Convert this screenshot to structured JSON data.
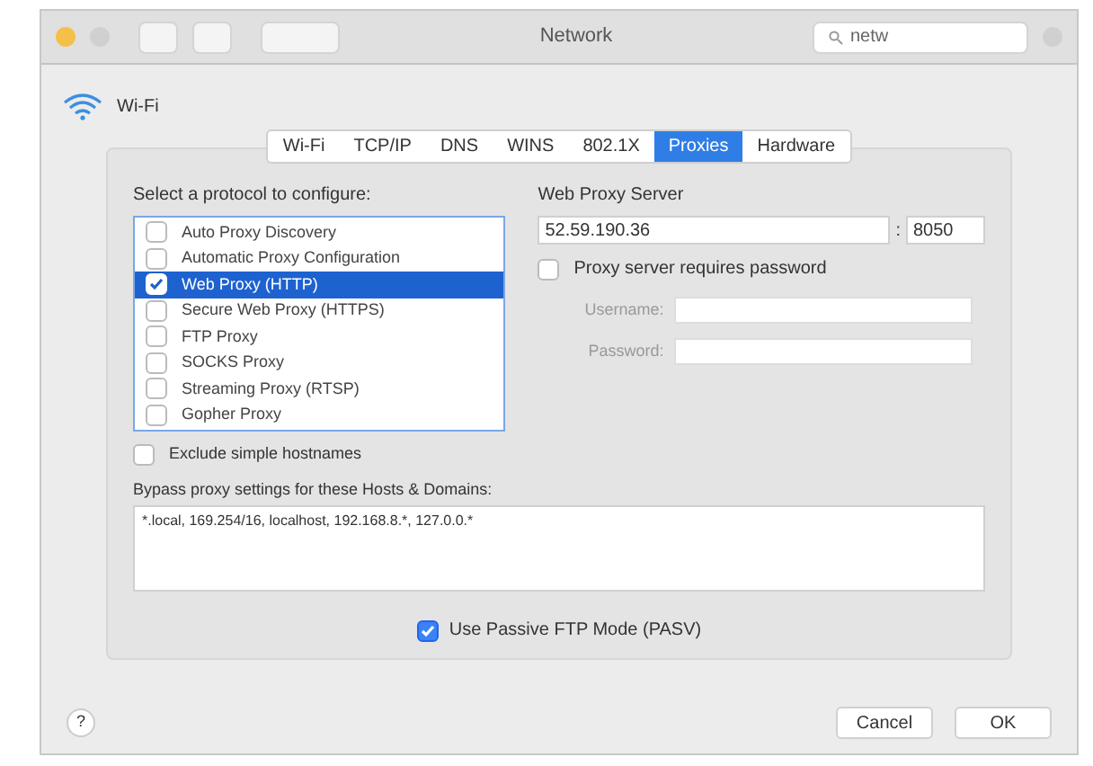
{
  "window": {
    "title": "Network"
  },
  "search": {
    "value": "netw"
  },
  "interface": {
    "name": "Wi-Fi"
  },
  "tabs": [
    {
      "label": "Wi-Fi",
      "selected": false
    },
    {
      "label": "TCP/IP",
      "selected": false
    },
    {
      "label": "DNS",
      "selected": false
    },
    {
      "label": "WINS",
      "selected": false
    },
    {
      "label": "802.1X",
      "selected": false
    },
    {
      "label": "Proxies",
      "selected": true
    },
    {
      "label": "Hardware",
      "selected": false
    }
  ],
  "protocols": {
    "label": "Select a protocol to configure:",
    "items": [
      {
        "label": "Auto Proxy Discovery",
        "checked": false,
        "selected": false
      },
      {
        "label": "Automatic Proxy Configuration",
        "checked": false,
        "selected": false
      },
      {
        "label": "Web Proxy (HTTP)",
        "checked": true,
        "selected": true
      },
      {
        "label": "Secure Web Proxy (HTTPS)",
        "checked": false,
        "selected": false
      },
      {
        "label": "FTP Proxy",
        "checked": false,
        "selected": false
      },
      {
        "label": "SOCKS Proxy",
        "checked": false,
        "selected": false
      },
      {
        "label": "Streaming Proxy (RTSP)",
        "checked": false,
        "selected": false
      },
      {
        "label": "Gopher Proxy",
        "checked": false,
        "selected": false
      }
    ]
  },
  "server": {
    "label": "Web Proxy Server",
    "host": "52.59.190.36",
    "separator": ":",
    "port": "8050",
    "requires_password": {
      "label": "Proxy server requires password",
      "checked": false
    },
    "username_label": "Username:",
    "password_label": "Password:"
  },
  "exclude_simple": {
    "label": "Exclude simple hostnames",
    "checked": false
  },
  "bypass": {
    "label": "Bypass proxy settings for these Hosts & Domains:",
    "value": "*.local, 169.254/16, localhost, 192.168.8.*, 127.0.0.*"
  },
  "passive_ftp": {
    "label": "Use Passive FTP Mode (PASV)",
    "checked": true
  },
  "help": "?",
  "buttons": [
    "Cancel",
    "OK"
  ]
}
